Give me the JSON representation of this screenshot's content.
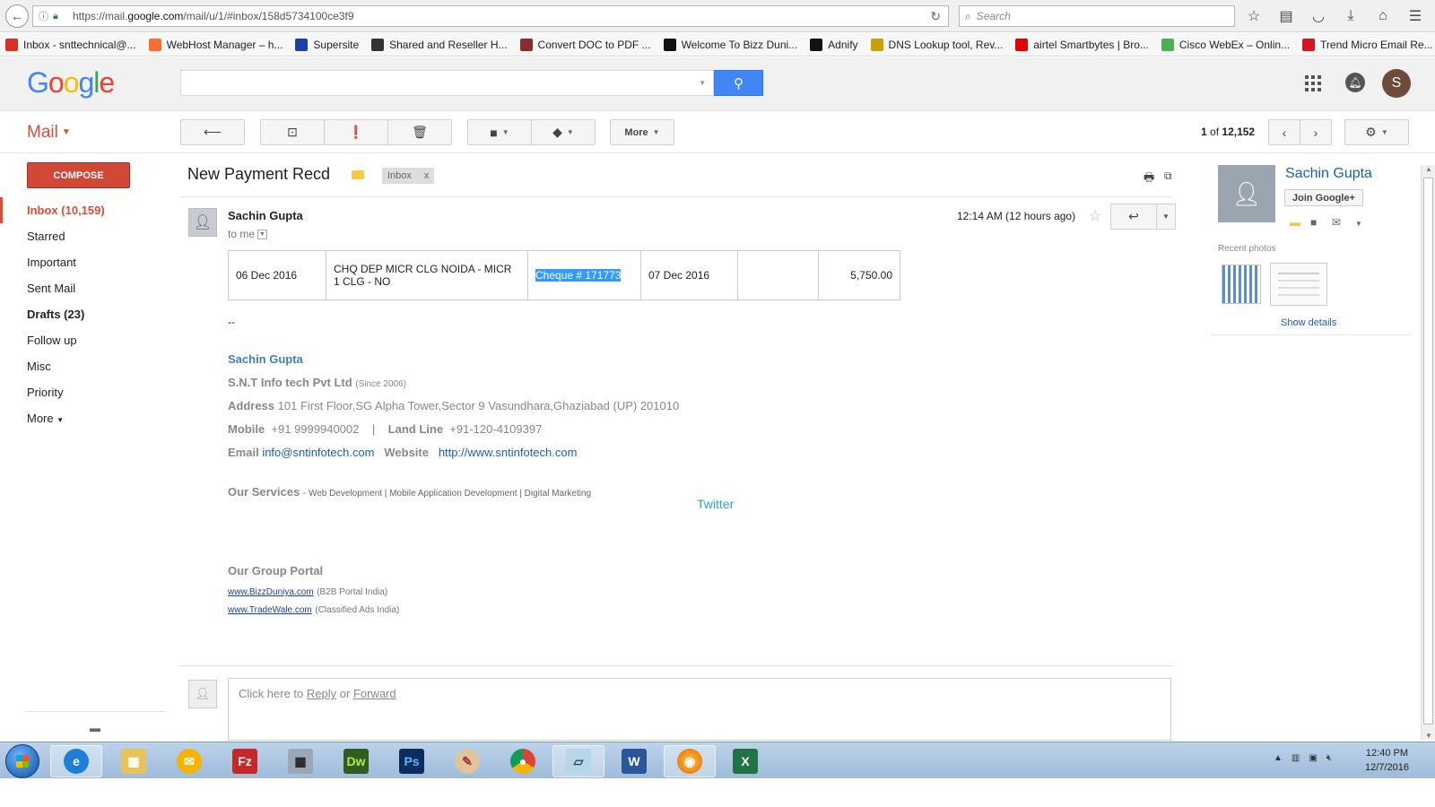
{
  "browser": {
    "url_pre": "https://mail.",
    "url_host": "google.com",
    "url_post": "/mail/u/1/#inbox/158d5734100ce3f9",
    "search_placeholder": "Search"
  },
  "bookmarks": [
    {
      "label": "Inbox - snttechnical@...",
      "icon": "gmail-icon",
      "color": "#d93025"
    },
    {
      "label": "WebHost Manager – h...",
      "icon": "cpanel-icon",
      "color": "#ff6c2c"
    },
    {
      "label": "Supersite",
      "icon": "supersite-icon",
      "color": "#1a3fa8"
    },
    {
      "label": "Shared and Reseller H...",
      "icon": "reseller-icon",
      "color": "#333333"
    },
    {
      "label": "Convert DOC to PDF ...",
      "icon": "convert-icon",
      "color": "#8b2b2b"
    },
    {
      "label": "Welcome To Bizz Duni...",
      "icon": "bizzduniya-icon",
      "color": "#111111"
    },
    {
      "label": "Adnify",
      "icon": "adnify-icon",
      "color": "#111111"
    },
    {
      "label": "DNS Lookup tool, Rev...",
      "icon": "dns-icon",
      "color": "#c8a200"
    },
    {
      "label": "airtel Smartbytes | Bro...",
      "icon": "airtel-icon",
      "color": "#e40000"
    },
    {
      "label": "Cisco WebEx – Onlin...",
      "icon": "webex-icon",
      "color": "#4caf50"
    },
    {
      "label": "Trend Micro Email Re...",
      "icon": "trendmicro-icon",
      "color": "#d7171f"
    }
  ],
  "header": {
    "logo_letters": [
      "G",
      "o",
      "o",
      "g",
      "l",
      "e"
    ],
    "avatar_initial": "S"
  },
  "toolbar": {
    "mail_label": "Mail",
    "more_label": "More",
    "counter_current": "1",
    "counter_of": "of",
    "counter_total": "12,152"
  },
  "sidebar": {
    "compose_label": "COMPOSE",
    "items": [
      {
        "label": "Inbox (10,159)"
      },
      {
        "label": "Starred"
      },
      {
        "label": "Important"
      },
      {
        "label": "Sent Mail"
      },
      {
        "label": "Drafts (23)"
      },
      {
        "label": "Follow up"
      },
      {
        "label": "Misc"
      },
      {
        "label": "Priority"
      },
      {
        "label": "More"
      }
    ]
  },
  "message": {
    "subject": "New Payment Recd",
    "label_chip": "Inbox",
    "label_chip_close": "x",
    "sender": "Sachin Gupta",
    "to": "to me",
    "time": "12:14 AM (12 hours ago)",
    "table": [
      [
        "06 Dec 2016",
        "CHQ DEP MICR CLG NOIDA - MICR 1 CLG - NO",
        "Cheque # 171773",
        "07 Dec 2016",
        "",
        "5,750.00"
      ]
    ],
    "dashes": "--",
    "signature": {
      "name": "Sachin Gupta",
      "company": "S.N.T  Info tech Pvt Ltd",
      "since": "(Since 2006)",
      "address_label": "Address",
      "address": "101 First Floor,SG Alpha Tower,Sector 9 Vasundhara,Ghaziabad (UP) 201010",
      "mobile_label": "Mobile",
      "mobile": "+91 9999940002",
      "sep": "|",
      "landline_label": "Land Line",
      "landline": "+91-120-4109397",
      "email_label": "Email",
      "email": "info@sntinfotech.com",
      "website_label": "Website",
      "website": "http://www.sntinfotech.com",
      "services_label": "Our Services",
      "services": "- Web  Development | Mobile Application Development | Digital Marketing",
      "twitter": "Twitter",
      "group_label": "Our Group Portal",
      "portal1": "www.BizzDuniya.com",
      "portal1_desc": "(B2B Portal India)",
      "portal2": "www.TradeWale.com",
      "portal2_desc": "(Classified Ads India)"
    },
    "reply_prefix": "Click here to",
    "reply_link": "Reply",
    "reply_or": "or",
    "forward_link": "Forward"
  },
  "contact": {
    "name": "Sachin Gupta",
    "join_label": "Join Google+",
    "recent_photos": "Recent photos",
    "show_details": "Show details"
  },
  "taskbar": {
    "time": "12:40 PM",
    "date": "12/7/2016"
  }
}
